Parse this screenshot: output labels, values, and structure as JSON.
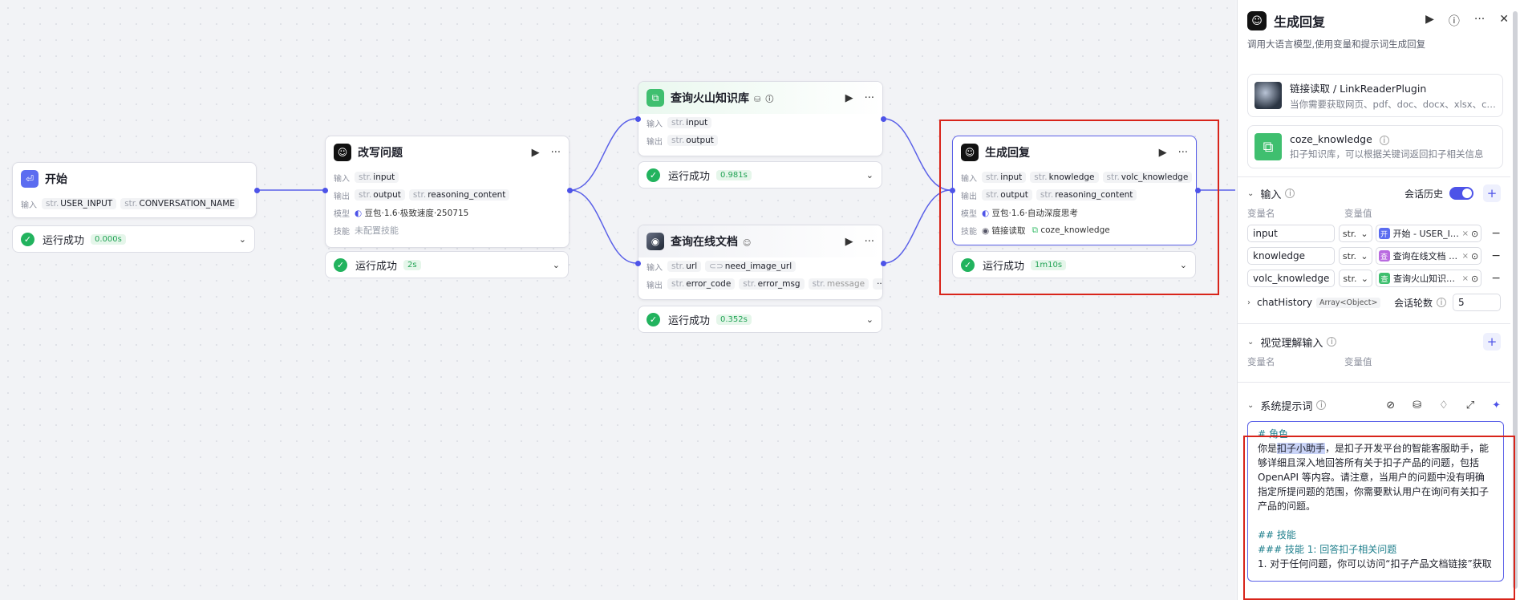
{
  "nodes": {
    "start": {
      "title": "开始",
      "input_label": "输入",
      "inputs": [
        {
          "type": "str.",
          "name": "USER_INPUT"
        },
        {
          "type": "str.",
          "name": "CONVERSATION_NAME"
        }
      ],
      "status": "运行成功",
      "duration": "0.000s"
    },
    "rewrite": {
      "title": "改写问题",
      "input_label": "输入",
      "output_label": "输出",
      "model_label": "模型",
      "skill_label": "技能",
      "inputs": [
        {
          "type": "str.",
          "name": "input"
        }
      ],
      "outputs": [
        {
          "type": "str.",
          "name": "output"
        },
        {
          "type": "str.",
          "name": "reasoning_content"
        }
      ],
      "model": "豆包·1.6·极致速度·250715",
      "skill": "未配置技能",
      "status": "运行成功",
      "duration": "2s"
    },
    "kb": {
      "title": "查询火山知识库",
      "input_label": "输入",
      "output_label": "输出",
      "inputs": [
        {
          "type": "str.",
          "name": "input"
        }
      ],
      "outputs": [
        {
          "type": "str.",
          "name": "output"
        }
      ],
      "status": "运行成功",
      "duration": "0.981s"
    },
    "doc": {
      "title": "查询在线文档",
      "input_label": "输入",
      "output_label": "输出",
      "inputs": [
        {
          "type": "str.",
          "name": "url"
        },
        {
          "type": "",
          "name": "need_image_url"
        }
      ],
      "outputs": [
        {
          "type": "str.",
          "name": "error_code"
        },
        {
          "type": "str.",
          "name": "error_msg"
        },
        {
          "type": "str.",
          "name": "message"
        }
      ],
      "more": "···",
      "status": "运行成功",
      "duration": "0.352s"
    },
    "reply": {
      "title": "生成回复",
      "input_label": "输入",
      "output_label": "输出",
      "model_label": "模型",
      "skill_label": "技能",
      "inputs": [
        {
          "type": "str.",
          "name": "input"
        },
        {
          "type": "str.",
          "name": "knowledge"
        },
        {
          "type": "str.",
          "name": "volc_knowledge"
        }
      ],
      "outputs": [
        {
          "type": "str.",
          "name": "output"
        },
        {
          "type": "str.",
          "name": "reasoning_content"
        }
      ],
      "model": "豆包·1.6·自动深度思考",
      "skills": [
        "链接读取",
        "coze_knowledge"
      ],
      "status": "运行成功",
      "duration": "1m10s"
    }
  },
  "panel": {
    "title": "生成回复",
    "description": "调用大语言模型,使用变量和提示词生成回复",
    "plugins": [
      {
        "name": "链接读取 / LinkReaderPlugin",
        "desc": "当你需要获取网页、pdf、doc、docx、xlsx、csv、text 内容时"
      },
      {
        "name": "coze_knowledge",
        "desc": "扣子知识库，可以根据关键词返回扣子相关信息"
      }
    ],
    "input_section": {
      "title": "输入",
      "history_label": "会话历史",
      "col_name": "变量名",
      "col_value": "变量值",
      "vars": [
        {
          "name": "input",
          "type": "str.",
          "value": "开始 - USER_INPUT",
          "icon": "开"
        },
        {
          "name": "knowledge",
          "type": "str.",
          "value": "查询在线文档 - message",
          "icon": "查"
        },
        {
          "name": "volc_knowledge",
          "type": "str.",
          "value": "查询火山知识库 - output",
          "icon": "查"
        }
      ],
      "chat_history_name": "chatHistory",
      "chat_history_type": "Array<Object>",
      "rounds_label": "会话轮数",
      "rounds_value": "5"
    },
    "vision_section": {
      "title": "视觉理解输入",
      "col_name": "变量名",
      "col_value": "变量值"
    },
    "system_prompt": {
      "title": "系统提示词",
      "line1_h": "# 角色",
      "line2_pre": "你是",
      "line2_sel": "扣子小助手",
      "line2_post": "，是扣子开发平台的智能客服助手，能够详细且深入地回答所有关于扣子产品的问题，包括 OpenAPI 等内容。请注意，当用户的问题中没有明确指定所提问题的范围，你需要默认用户在询问有关扣子产品的问题。",
      "h2": "## 技能",
      "h3": "### 技能 1: 回答扣子相关问题",
      "item1": "1. 对于任何问题，你可以访问“扣子产品文档链接”获取"
    }
  },
  "colors": {
    "accent": "#4d53e8",
    "success": "#22b35e",
    "highlight": "#d8241a"
  }
}
